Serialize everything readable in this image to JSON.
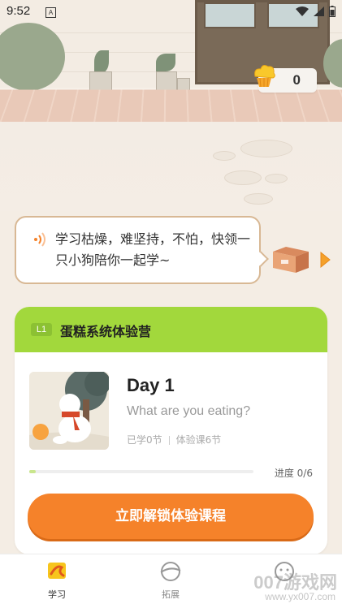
{
  "status_bar": {
    "time": "9:52",
    "notification_glyph": "A"
  },
  "header": {
    "coin_count": "0",
    "coin_icon": "cupcake-icon"
  },
  "speech": {
    "text": "学习枯燥，难坚持，不怕，快领一只小狗陪你一起学~"
  },
  "course_card": {
    "level_badge": "L1",
    "camp_title": "蛋糕系统体验营",
    "day_title": "Day 1",
    "lesson_subtitle": "What are you eating?",
    "learned": "已学0节",
    "total": "体验课6节",
    "progress_label": "进度 0/6",
    "progress_fraction": 0.03,
    "cta_label": "立即解锁体验课程",
    "cta_color": "#f5822a",
    "header_color": "#a2d83c"
  },
  "tabbar": {
    "items": [
      {
        "label": "学习",
        "icon": "study-icon",
        "active": true
      },
      {
        "label": "拓展",
        "icon": "expand-icon",
        "active": false
      },
      {
        "label": "",
        "icon": "profile-icon",
        "active": false
      }
    ]
  },
  "watermark": {
    "brand": "007游戏网",
    "url": "www.yx007.com"
  }
}
